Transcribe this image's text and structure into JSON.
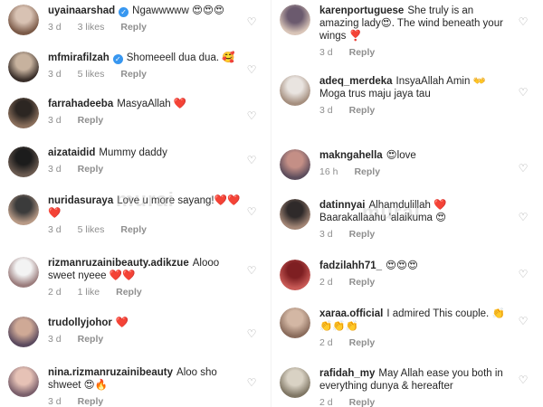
{
  "left": [
    {
      "user": "uyainaarshad",
      "verified": true,
      "text": "Ngawwwww 😍😍😍",
      "time": "3 d",
      "likes": "3 likes",
      "reply": "Reply",
      "av": [
        "#d8c2b3",
        "#7b5a48"
      ]
    },
    {
      "user": "mfmirafilzah",
      "verified": true,
      "text": "Shomeeell dua dua. 🥰",
      "time": "3 d",
      "likes": "5 likes",
      "reply": "Reply",
      "av": [
        "#c7b29e",
        "#3a2f2a"
      ]
    },
    {
      "user": "farrahadeeba",
      "verified": false,
      "text": "MasyaAllah ❤️",
      "time": "3 d",
      "likes": "",
      "reply": "Reply",
      "av": [
        "#2c2622",
        "#8a6f5c"
      ]
    },
    {
      "user": "aizataidid",
      "verified": false,
      "text": "Mummy daddy",
      "time": "3 d",
      "likes": "",
      "reply": "Reply",
      "av": [
        "#1c1c1c",
        "#6a5a50"
      ]
    },
    {
      "user": "nuridasuraya",
      "verified": false,
      "text": "Love u more sayang!❤️❤️❤️",
      "time": "3 d",
      "likes": "5 likes",
      "reply": "Reply",
      "av": [
        "#3b3b3b",
        "#b89a86"
      ]
    },
    {
      "user": "rizmanruzainibeauty.adikzue",
      "verified": false,
      "text": "Alooo sweet nyeee ❤️❤️",
      "time": "2 d",
      "likes": "1 like",
      "reply": "Reply",
      "av": [
        "#f3f3f3",
        "#9b7d7d"
      ]
    },
    {
      "user": "trudollyjohor",
      "verified": false,
      "text": "❤️",
      "time": "3 d",
      "likes": "",
      "reply": "Reply",
      "av": [
        "#cfa996",
        "#5b4a5e"
      ]
    },
    {
      "user": "nina.rizmanruzainibeauty",
      "verified": false,
      "text": "Aloo sho shweet 😍🔥",
      "time": "3 d",
      "likes": "",
      "reply": "Reply",
      "av": [
        "#e6c2b6",
        "#7a5f6b"
      ]
    }
  ],
  "right": [
    {
      "user": "karenportuguese",
      "verified": false,
      "text": "She truly is an amazing lady😍. The wind beneath your wings ❣️",
      "time": "3 d",
      "likes": "",
      "reply": "Reply",
      "av": [
        "#6b5a6e",
        "#d9c5b8"
      ]
    },
    {
      "user": "adeq_merdeka",
      "verified": false,
      "text": "InsyaAllah Amin 👐 Moga trus maju jaya tau",
      "time": "3 d",
      "likes": "",
      "reply": "Reply",
      "av": [
        "#e9e4e0",
        "#a58f7f"
      ]
    },
    {
      "user": "makngahella",
      "verified": false,
      "text": "😍love",
      "time": "16 h",
      "likes": "",
      "reply": "Reply",
      "av": [
        "#c48f86",
        "#5d4d5c"
      ]
    },
    {
      "user": "datinnyai",
      "verified": false,
      "text": "Alhamdulillah ❤️ Baarakallaahu 'alaikuma 😍",
      "time": "3 d",
      "likes": "",
      "reply": "Reply",
      "av": [
        "#2f2a2a",
        "#a38676"
      ]
    },
    {
      "user": "fadzilahh71_",
      "verified": false,
      "text": "😍😍😍",
      "time": "2 d",
      "likes": "",
      "reply": "Reply",
      "av": [
        "#7e1f22",
        "#c85a56"
      ]
    },
    {
      "user": "xaraa.official",
      "verified": false,
      "text": "I admired This couple. 👏 👏👏👏",
      "time": "2 d",
      "likes": "",
      "reply": "Reply",
      "av": [
        "#d3b7a4",
        "#8a6c5c"
      ]
    },
    {
      "user": "rafidah_my",
      "verified": false,
      "text": "May Allah ease you both in everything dunya & hereafter",
      "time": "2 d",
      "likes": "",
      "reply": "Reply",
      "av": [
        "#d9d2c4",
        "#7f7664"
      ]
    }
  ],
  "watermark": [
    "murai",
    "murai"
  ],
  "colors": {
    "verified": "#3897f0",
    "meta": "#8e8e8e",
    "heart_icon": "#9a9a9a"
  },
  "icons": {
    "like": "heart-outline-icon",
    "verified": "verified-badge-icon"
  }
}
